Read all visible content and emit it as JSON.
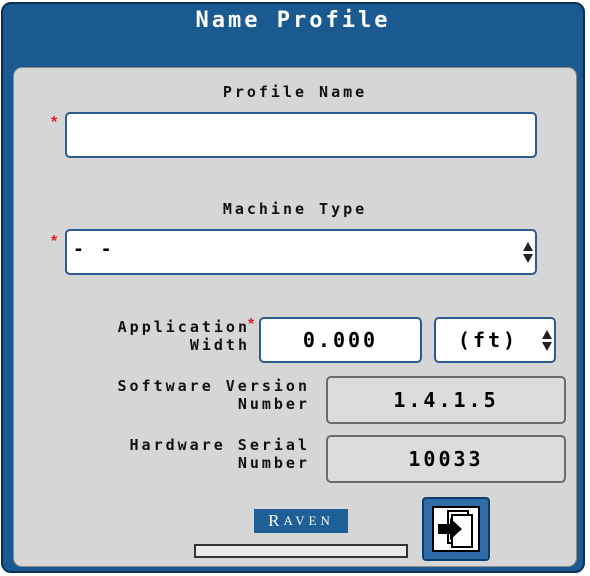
{
  "window": {
    "title": "Name Profile"
  },
  "profile_name": {
    "label": "Profile Name",
    "required_mark": "*",
    "value": ""
  },
  "machine_type": {
    "label": "Machine Type",
    "required_mark": "*",
    "value": "- -"
  },
  "application_width": {
    "label_line1": "Application",
    "label_line2": "Width",
    "required_mark": "*",
    "value": "0.000",
    "unit": "(ft)"
  },
  "software_version": {
    "label_line1": "Software Version",
    "label_line2": "Number",
    "value": "1.4.1.5"
  },
  "hardware_serial": {
    "label_line1": "Hardware Serial",
    "label_line2": "Number",
    "value": "10033"
  },
  "brand": {
    "logo_text": "RAVEN",
    "logo_first": "R",
    "logo_rest": "AVEN"
  },
  "progress": {
    "fraction": 0
  },
  "next_button": {
    "icon": "next-page-icon"
  },
  "colors": {
    "title_bar": "#1a5a90",
    "panel": "#d6d6d6",
    "field_border": "#2a5d8f",
    "required": "#e02020",
    "brand": "#1f5f98"
  }
}
